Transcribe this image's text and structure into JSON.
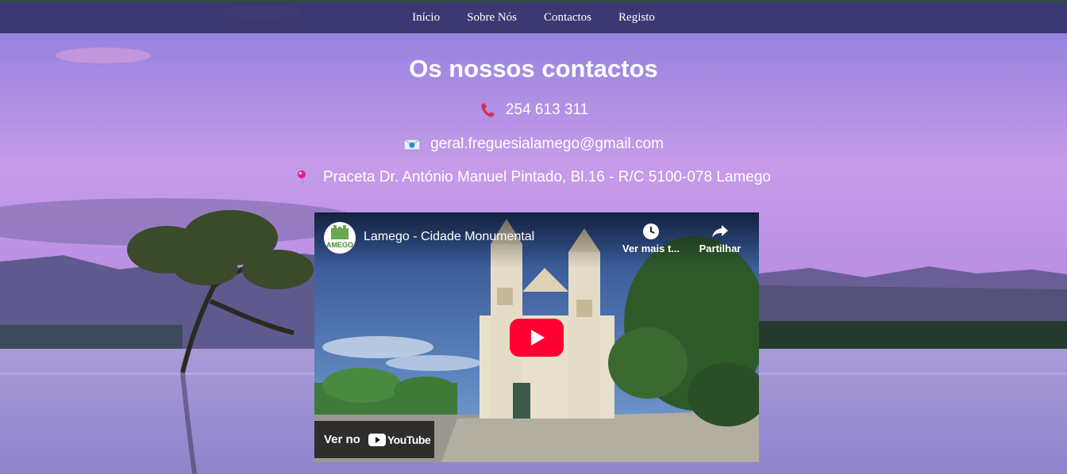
{
  "nav": {
    "items": [
      "Início",
      "Sobre Nós",
      "Contactos",
      "Registo"
    ]
  },
  "page": {
    "title": "Os nossos contactos"
  },
  "contacts": {
    "phone": "254 613 311",
    "email": "geral.freguesialamego@gmail.com",
    "address": "Praceta Dr. António Manuel Pintado, Bl.16 - R/C 5100-078 Lamego",
    "phone_icon": "phone-icon",
    "email_icon": "email-icon",
    "address_icon": "map-pin-icon"
  },
  "video": {
    "title": "Lamego - Cidade Monumental",
    "channel_logo_text": "AMEGO",
    "watch_later_label": "Ver mais t...",
    "share_label": "Partilhar",
    "watch_on_label": "Ver no",
    "youtube_label": "YouTube"
  },
  "colors": {
    "nav_bg": "#28285c",
    "youtube_red": "#ff0033",
    "phone_red": "#d32f5a",
    "pin_pink": "#e0218a"
  }
}
